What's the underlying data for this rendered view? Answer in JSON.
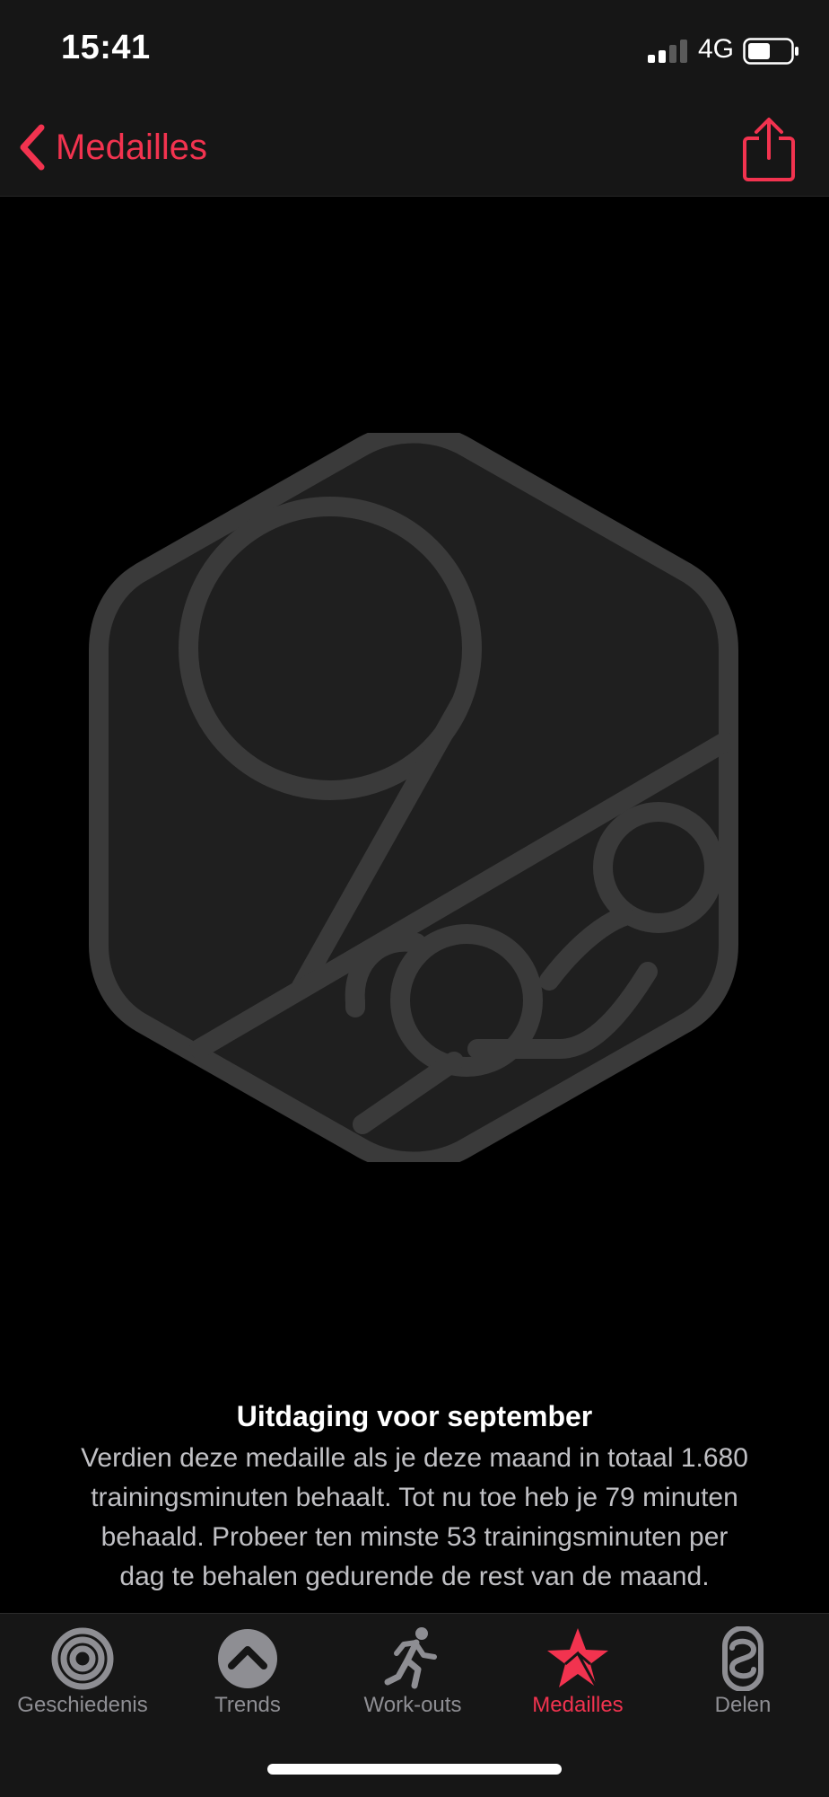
{
  "status_bar": {
    "time": "15:41",
    "network": "4G",
    "icons": [
      "signal-icon",
      "battery-icon"
    ]
  },
  "nav": {
    "back_label": "Medailles",
    "icons": [
      "chevron-left-icon",
      "share-icon"
    ]
  },
  "medal": {
    "icon": "september-2020-medal"
  },
  "challenge": {
    "title": "Uitdaging voor september",
    "lines": [
      "Verdien deze medaille als je deze maand in totaal 1.680",
      "trainingsminuten behaalt. Tot nu toe heb je 79 minuten",
      "behaald. Probeer ten minste 53 trainingsminuten per",
      "dag te behalen gedurende de rest van de maand."
    ]
  },
  "tabs": [
    {
      "label": "Geschiedenis",
      "icon": "activity-rings-icon",
      "active": false
    },
    {
      "label": "Trends",
      "icon": "trends-chevron-icon",
      "active": false
    },
    {
      "label": "Work-outs",
      "icon": "runner-icon",
      "active": false
    },
    {
      "label": "Medailles",
      "icon": "star-medal-icon",
      "active": true
    },
    {
      "label": "Delen",
      "icon": "sharing-rings-icon",
      "active": false
    }
  ],
  "colors": {
    "accent": "#f2334f",
    "bar_background": "#161616",
    "inactive": "#8e8e93",
    "medal_fill": "#1f1f1f",
    "medal_stroke": "#3a3a3a"
  }
}
